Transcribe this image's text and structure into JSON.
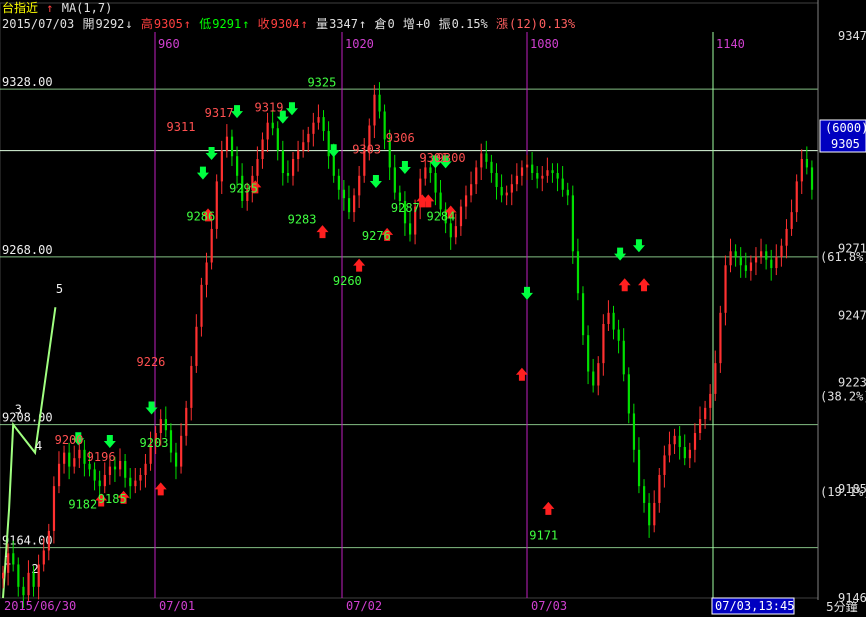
{
  "header": {
    "symbol": "台指近",
    "indicator": "MA(1,7)",
    "date": "2015/07/03",
    "open_label": "開",
    "open": "9292",
    "open_arrow": "↓",
    "high_label": "高",
    "high": "9305",
    "high_arrow": "↑",
    "low_label": "低",
    "low": "9291",
    "low_arrow": "↑",
    "close_label": "收",
    "close": "9304",
    "close_arrow": "↑",
    "volume_label": "量",
    "volume": "3347",
    "volume_arrow": "↑",
    "oi_label": "倉",
    "oi": "0",
    "oi_change_label": "增",
    "oi_change": "+0",
    "amplitude_label": "振",
    "amplitude": "0.15%",
    "change_label": "漲",
    "change": "(12)",
    "change_pct": "0.13%"
  },
  "colors": {
    "up": "#ff3030",
    "down": "#00e000",
    "minute_line": "#c020c0",
    "hgrid": "#b0ffb0",
    "date_line": "#c020c0",
    "wave_line": "#a0ff80",
    "annotation_up": "#ff5050",
    "annotation_down": "#40ff40",
    "price_box": "#0000c0"
  },
  "chart_data": {
    "type": "candlestick",
    "interval": "5分鐘",
    "ylim": [
      9146,
      9347
    ],
    "minute_markers": [
      "960",
      "1020",
      "1080",
      "1140"
    ],
    "date_labels": [
      "2015/06/30",
      "07/01",
      "07/02",
      "07/03"
    ],
    "cursor_label": "07/03,13:45",
    "axis_labels": [
      "9347",
      "9271",
      "9247",
      "9223",
      "9185",
      "9146"
    ],
    "gridline_labels": [
      {
        "text": "9328.00",
        "value": 9328
      },
      {
        "text": "9268.00",
        "value": 9268
      },
      {
        "text": "9208.00",
        "value": 9208
      },
      {
        "text": "9164.00",
        "value": 9164
      }
    ],
    "fib_levels": [
      {
        "text": "(61.8%)",
        "value": 9268
      },
      {
        "text": "(38.2%)",
        "value": 9218
      },
      {
        "text": "(19.1%)",
        "value": 9184
      }
    ],
    "price_box": {
      "top": "(6000)",
      "value": "9305"
    },
    "price_line": 9306,
    "wave_labels": [
      {
        "text": "1",
        "x": 0.2,
        "value": 9158
      },
      {
        "text": "2",
        "x": 5.6,
        "value": 9155
      },
      {
        "text": "3",
        "x": 2.3,
        "value": 9212
      },
      {
        "text": "4",
        "x": 6.3,
        "value": 9199
      },
      {
        "text": "5",
        "x": 10.4,
        "value": 9255
      }
    ],
    "wave_points": [
      {
        "x": 0,
        "value": 9146
      },
      {
        "x": 1.2,
        "value": 9178
      },
      {
        "x": 2.0,
        "value": 9208
      },
      {
        "x": 6.3,
        "value": 9198
      },
      {
        "x": 10.3,
        "value": 9250
      }
    ],
    "annotations": [
      {
        "text": "9200",
        "x": 12.5,
        "value": 9201,
        "color": "up"
      },
      {
        "text": "9196",
        "x": 18.8,
        "value": 9195,
        "color": "up"
      },
      {
        "text": "9182",
        "x": 15.2,
        "value": 9178,
        "color": "down"
      },
      {
        "text": "9185",
        "x": 21.0,
        "value": 9180,
        "color": "down"
      },
      {
        "text": "9203",
        "x": 29.2,
        "value": 9200,
        "color": "down"
      },
      {
        "text": "9226",
        "x": 28.6,
        "value": 9229,
        "color": "up"
      },
      {
        "text": "9311",
        "x": 34.5,
        "value": 9313,
        "color": "up"
      },
      {
        "text": "9286",
        "x": 38.4,
        "value": 9281,
        "color": "down"
      },
      {
        "text": "9317",
        "x": 42.0,
        "value": 9318,
        "color": "up"
      },
      {
        "text": "9295",
        "x": 46.8,
        "value": 9291,
        "color": "down"
      },
      {
        "text": "9319",
        "x": 51.8,
        "value": 9320,
        "color": "up"
      },
      {
        "text": "9283",
        "x": 58.3,
        "value": 9280,
        "color": "down"
      },
      {
        "text": "9325",
        "x": 62.2,
        "value": 9329,
        "color": "down"
      },
      {
        "text": "9303",
        "x": 71.0,
        "value": 9305,
        "color": "up"
      },
      {
        "text": "9276",
        "x": 72.9,
        "value": 9274,
        "color": "down"
      },
      {
        "text": "9260",
        "x": 67.2,
        "value": 9258,
        "color": "down"
      },
      {
        "text": "9306",
        "x": 77.6,
        "value": 9309,
        "color": "up"
      },
      {
        "text": "9287",
        "x": 78.6,
        "value": 9284,
        "color": "down"
      },
      {
        "text": "9301",
        "x": 84.2,
        "value": 9302,
        "color": "up"
      },
      {
        "text": "9300",
        "x": 87.6,
        "value": 9302,
        "color": "up"
      },
      {
        "text": "9284",
        "x": 85.6,
        "value": 9281,
        "color": "down"
      },
      {
        "text": "9171",
        "x": 105.8,
        "value": 9167,
        "color": "down"
      }
    ],
    "signals": [
      {
        "x": 14.8,
        "dir": "down",
        "value": 9201
      },
      {
        "x": 21.0,
        "dir": "down",
        "value": 9200
      },
      {
        "x": 19.3,
        "dir": "up",
        "value": 9183
      },
      {
        "x": 23.7,
        "dir": "up",
        "value": 9184
      },
      {
        "x": 29.2,
        "dir": "down",
        "value": 9212
      },
      {
        "x": 31.0,
        "dir": "up",
        "value": 9187
      },
      {
        "x": 39.3,
        "dir": "down",
        "value": 9296
      },
      {
        "x": 41.0,
        "dir": "down",
        "value": 9303
      },
      {
        "x": 40.3,
        "dir": "up",
        "value": 9285
      },
      {
        "x": 46.0,
        "dir": "down",
        "value": 9318
      },
      {
        "x": 49.6,
        "dir": "up",
        "value": 9295
      },
      {
        "x": 55.0,
        "dir": "down",
        "value": 9316
      },
      {
        "x": 56.8,
        "dir": "down",
        "value": 9319
      },
      {
        "x": 62.8,
        "dir": "up",
        "value": 9279
      },
      {
        "x": 65.0,
        "dir": "down",
        "value": 9304
      },
      {
        "x": 70.0,
        "dir": "up",
        "value": 9267
      },
      {
        "x": 73.3,
        "dir": "down",
        "value": 9293
      },
      {
        "x": 75.5,
        "dir": "up",
        "value": 9278
      },
      {
        "x": 79.0,
        "dir": "down",
        "value": 9298
      },
      {
        "x": 82.4,
        "dir": "up",
        "value": 9290
      },
      {
        "x": 83.6,
        "dir": "up",
        "value": 9290
      },
      {
        "x": 85.0,
        "dir": "down",
        "value": 9300
      },
      {
        "x": 87.0,
        "dir": "down",
        "value": 9300
      },
      {
        "x": 88.0,
        "dir": "up",
        "value": 9286
      },
      {
        "x": 103.0,
        "dir": "down",
        "value": 9253
      },
      {
        "x": 102.0,
        "dir": "up",
        "value": 9228
      },
      {
        "x": 107.2,
        "dir": "up",
        "value": 9180
      },
      {
        "x": 121.3,
        "dir": "down",
        "value": 9267
      },
      {
        "x": 125.0,
        "dir": "down",
        "value": 9270
      },
      {
        "x": 122.2,
        "dir": "up",
        "value": 9260
      },
      {
        "x": 126.0,
        "dir": "up",
        "value": 9260
      }
    ],
    "closes": [
      9155,
      9162,
      9158,
      9150,
      9147,
      9155,
      9150,
      9158,
      9163,
      9170,
      9186,
      9194,
      9198,
      9193,
      9196,
      9199,
      9194,
      9192,
      9188,
      9186,
      9190,
      9193,
      9192,
      9195,
      9189,
      9186,
      9188,
      9190,
      9194,
      9201,
      9205,
      9210,
      9206,
      9198,
      9193,
      9204,
      9214,
      9229,
      9243,
      9258,
      9266,
      9278,
      9295,
      9306,
      9311,
      9304,
      9297,
      9288,
      9292,
      9297,
      9303,
      9310,
      9316,
      9314,
      9306,
      9298,
      9297,
      9303,
      9306,
      9309,
      9312,
      9316,
      9318,
      9313,
      9304,
      9297,
      9292,
      9289,
      9284,
      9290,
      9297,
      9306,
      9315,
      9326,
      9320,
      9310,
      9300,
      9291,
      9288,
      9280,
      9276,
      9286,
      9296,
      9300,
      9298,
      9291,
      9285,
      9280,
      9275,
      9279,
      9286,
      9290,
      9294,
      9300,
      9305,
      9302,
      9298,
      9293,
      9290,
      9291,
      9294,
      9297,
      9300,
      9301,
      9298,
      9296,
      9297,
      9299,
      9298,
      9296,
      9292,
      9290,
      9270,
      9255,
      9240,
      9227,
      9222,
      9230,
      9244,
      9248,
      9242,
      9238,
      9226,
      9212,
      9199,
      9186,
      9180,
      9172,
      9180,
      9190,
      9197,
      9201,
      9204,
      9200,
      9196,
      9199,
      9205,
      9210,
      9214,
      9219,
      9230,
      9248,
      9265,
      9270,
      9268,
      9265,
      9263,
      9266,
      9268,
      9270,
      9267,
      9264,
      9268,
      9272,
      9278,
      9284,
      9295,
      9303,
      9300,
      9292
    ]
  },
  "footer": {
    "interval": "5分鐘"
  }
}
